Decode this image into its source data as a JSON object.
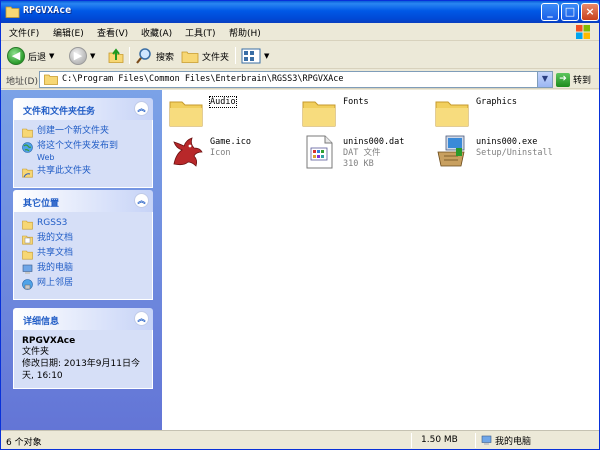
{
  "window": {
    "title": "RPGVXAce"
  },
  "menu": [
    "文件(F)",
    "编辑(E)",
    "查看(V)",
    "收藏(A)",
    "工具(T)",
    "帮助(H)"
  ],
  "toolbar": {
    "back_label": "后退",
    "search_label": "搜索",
    "folders_label": "文件夹"
  },
  "address": {
    "label": "地址(D)",
    "path": "C:\\Program Files\\Common Files\\Enterbrain\\RGSS3\\RPGVXAce",
    "go_label": "转到"
  },
  "tasks": {
    "title": "文件和文件夹任务",
    "items": [
      {
        "label": "创建一个新文件夹",
        "sub": ""
      },
      {
        "label": "将这个文件夹发布到",
        "sub": "Web"
      },
      {
        "label": "共享此文件夹",
        "sub": ""
      }
    ]
  },
  "places": {
    "title": "其它位置",
    "items": [
      "RGSS3",
      "我的文档",
      "共享文档",
      "我的电脑",
      "网上邻居"
    ]
  },
  "details": {
    "title": "详细信息",
    "name": "RPGVXAce",
    "type": "文件夹",
    "modified_line1": "修改日期: 2013年9月11日今",
    "modified_line2": "天, 16:10"
  },
  "files": [
    {
      "name": "Audio",
      "sub1": "",
      "sub2": "",
      "icon": "folder-icon"
    },
    {
      "name": "Fonts",
      "sub1": "",
      "sub2": "",
      "icon": "folder-icon"
    },
    {
      "name": "Graphics",
      "sub1": "",
      "sub2": "",
      "icon": "folder-icon"
    },
    {
      "name": "Game.ico",
      "sub1": "Icon",
      "sub2": "",
      "icon": "dragon-icon"
    },
    {
      "name": "unins000.dat",
      "sub1": "DAT 文件",
      "sub2": "310 KB",
      "icon": "dat-file-icon"
    },
    {
      "name": "unins000.exe",
      "sub1": "Setup/Uninstall",
      "sub2": "",
      "icon": "installer-icon"
    }
  ],
  "status": {
    "count": "6 个对象",
    "size": "1.50 MB",
    "location": "我的电脑"
  }
}
